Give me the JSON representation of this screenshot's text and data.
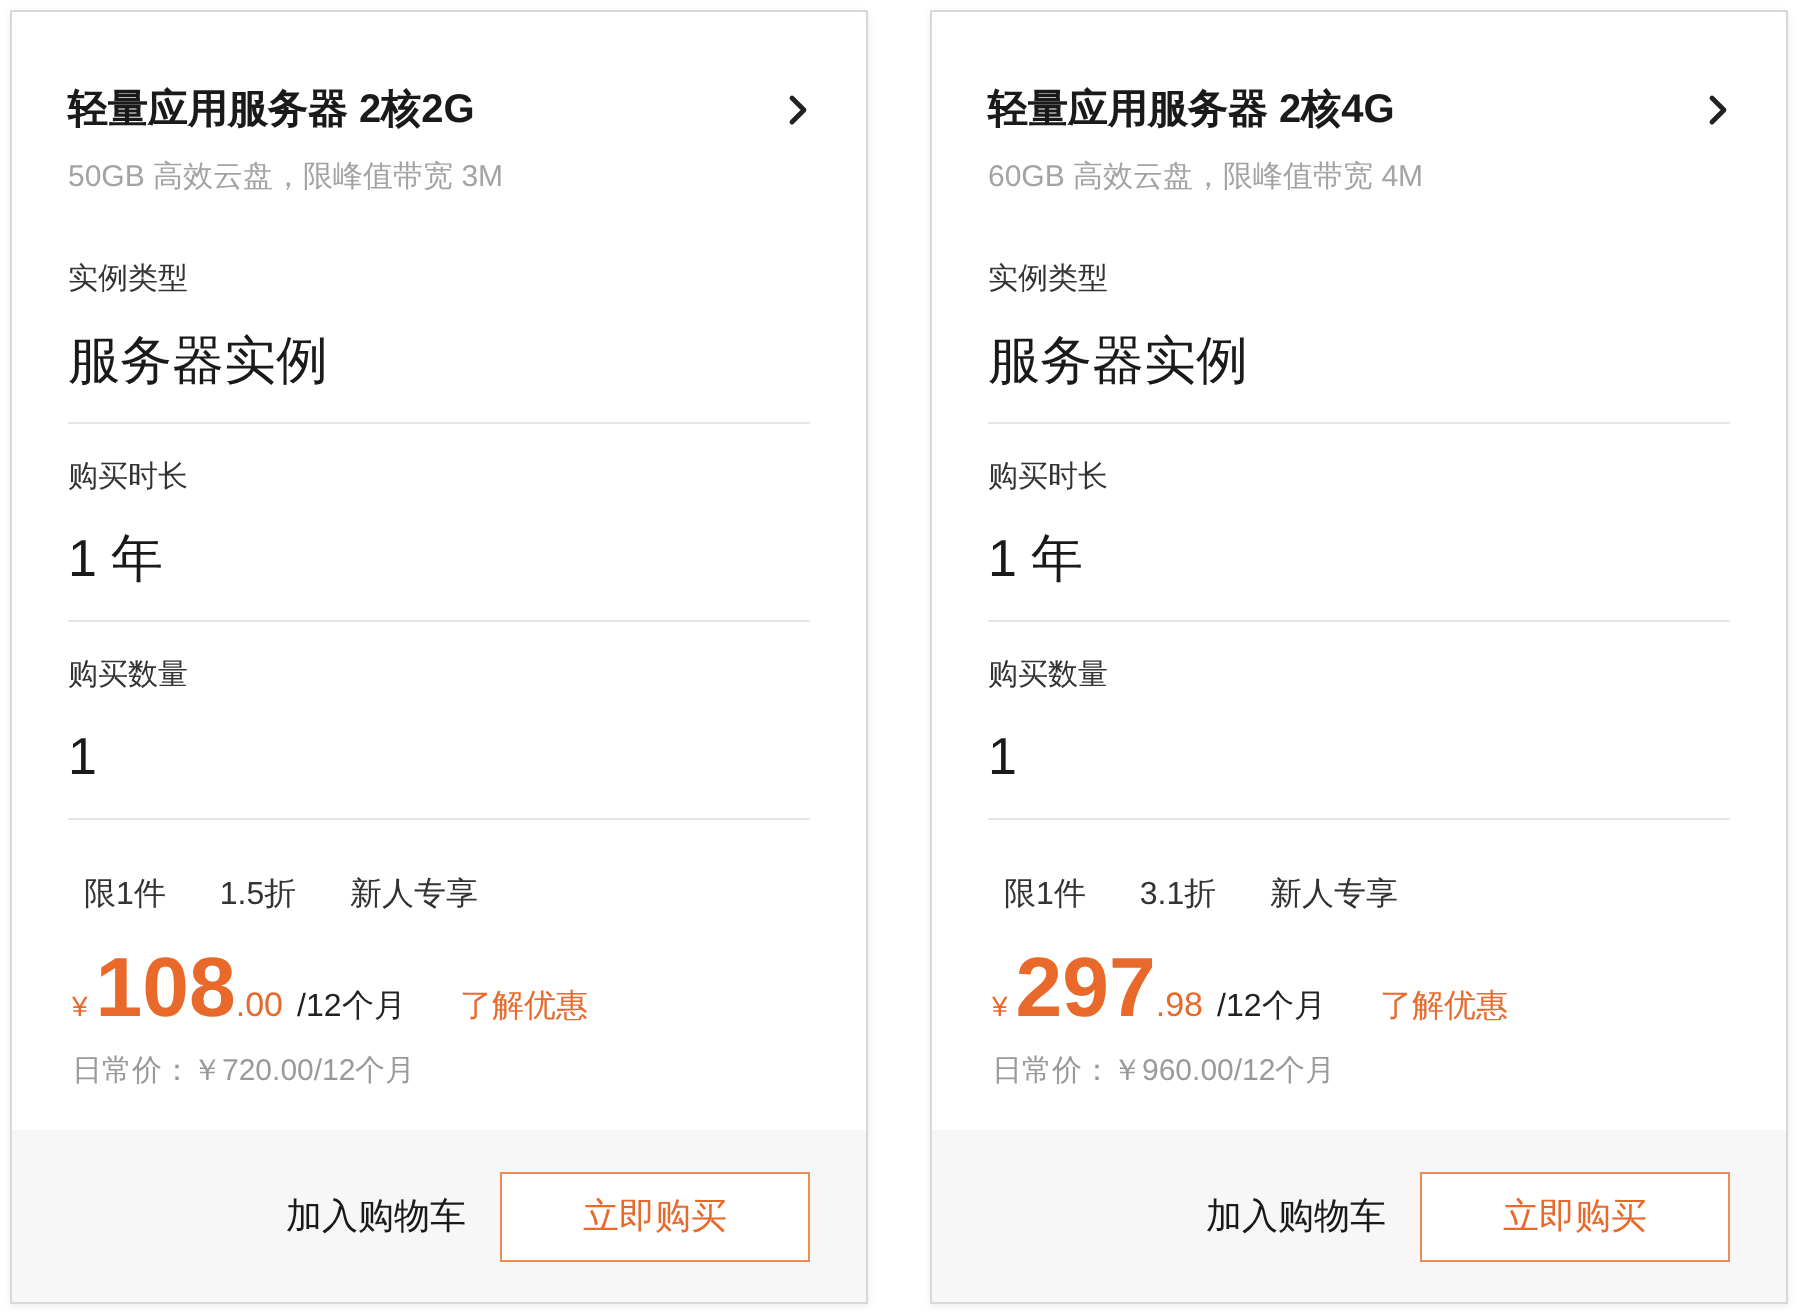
{
  "cards": [
    {
      "title": "轻量应用服务器 2核2G",
      "subtitle": "50GB 高效云盘，限峰值带宽 3M",
      "fields": [
        {
          "label": "实例类型",
          "value": "服务器实例"
        },
        {
          "label": "购买时长",
          "value": "1 年"
        },
        {
          "label": "购买数量",
          "value": "1"
        }
      ],
      "tags": [
        "限1件",
        "1.5折",
        "新人专享"
      ],
      "price": {
        "currency": "¥",
        "integer": "108",
        "decimal": ".00",
        "period": "/12个月"
      },
      "promo_link": "了解优惠",
      "regular_price": "日常价：￥720.00/12个月",
      "add_to_cart": "加入购物车",
      "buy_now": "立即购买"
    },
    {
      "title": "轻量应用服务器 2核4G",
      "subtitle": "60GB 高效云盘，限峰值带宽 4M",
      "fields": [
        {
          "label": "实例类型",
          "value": "服务器实例"
        },
        {
          "label": "购买时长",
          "value": "1 年"
        },
        {
          "label": "购买数量",
          "value": "1"
        }
      ],
      "tags": [
        "限1件",
        "3.1折",
        "新人专享"
      ],
      "price": {
        "currency": "¥",
        "integer": "297",
        "decimal": ".98",
        "period": "/12个月"
      },
      "promo_link": "了解优惠",
      "regular_price": "日常价：￥960.00/12个月",
      "add_to_cart": "加入购物车",
      "buy_now": "立即购买"
    }
  ]
}
